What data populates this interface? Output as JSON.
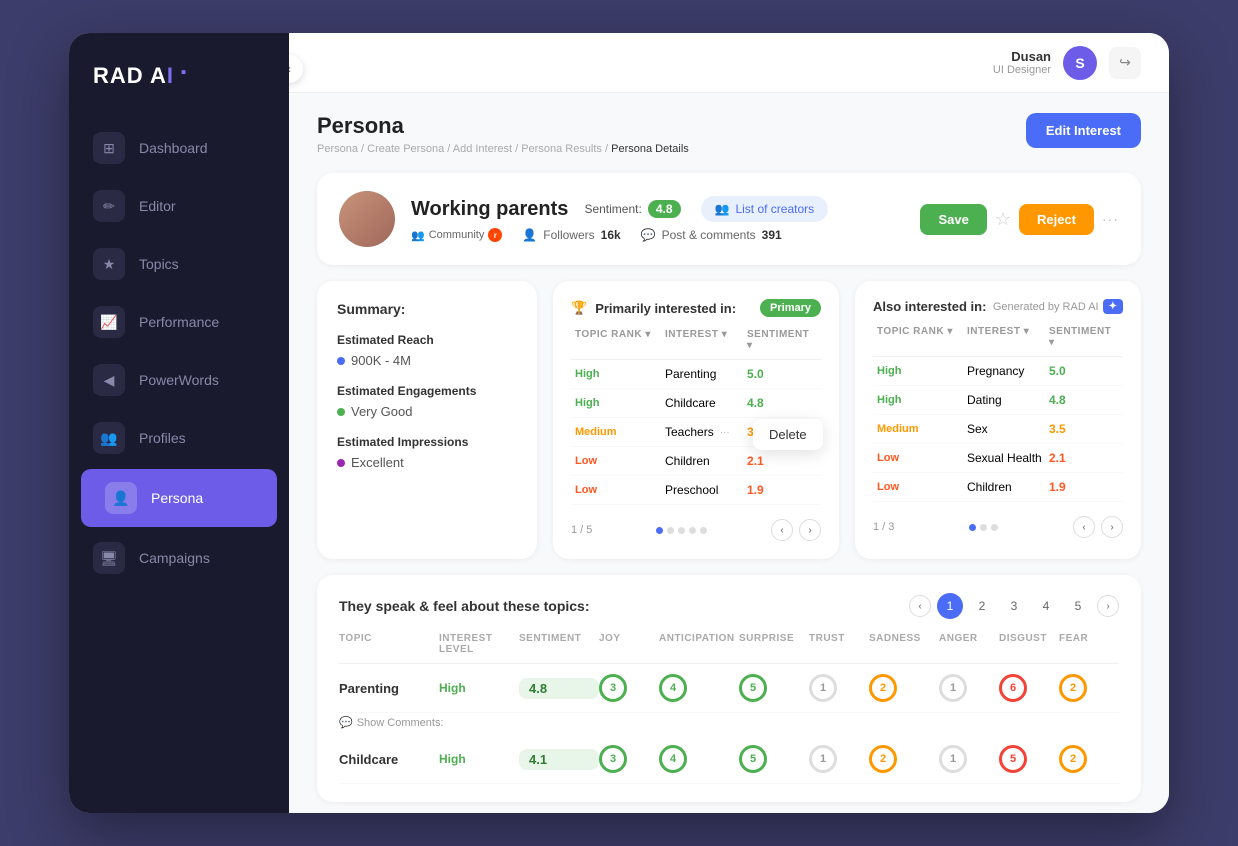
{
  "app": {
    "logo": "RAD AI",
    "logo_dot": "●"
  },
  "header": {
    "user_name": "Dusan",
    "user_role": "UI Designer",
    "avatar_letter": "S",
    "back_arrow": "‹"
  },
  "sidebar": {
    "items": [
      {
        "id": "dashboard",
        "label": "Dashboard",
        "icon": "⊞"
      },
      {
        "id": "editor",
        "label": "Editor",
        "icon": "✏"
      },
      {
        "id": "topics",
        "label": "Topics",
        "icon": "★"
      },
      {
        "id": "performance",
        "label": "Performance",
        "icon": "📈"
      },
      {
        "id": "powerwords",
        "label": "PowerWords",
        "icon": "◀"
      },
      {
        "id": "profiles",
        "label": "Profiles",
        "icon": "👥"
      },
      {
        "id": "persona",
        "label": "Persona",
        "icon": "👤",
        "active": true
      },
      {
        "id": "campaigns",
        "label": "Campaigns",
        "icon": "🖥"
      }
    ]
  },
  "page": {
    "title": "Persona",
    "breadcrumb": "Persona / Create Persona / Add Interest / Persona Results / Persona Details",
    "breadcrumb_active": "Persona Details",
    "edit_btn": "Edit Interest"
  },
  "profile": {
    "name": "Working parents",
    "sentiment_label": "Sentiment:",
    "sentiment_value": "4.8",
    "creators_btn": "List of creators",
    "community": "Community",
    "followers_label": "Followers",
    "followers_value": "16k",
    "post_comments_label": "Post & comments",
    "post_comments_value": "391",
    "save_btn": "Save",
    "reject_btn": "Reject"
  },
  "summary": {
    "title": "Summary:",
    "reach_label": "Estimated Reach",
    "reach_value": "900K - 4M",
    "engagements_label": "Estimated Engagements",
    "engagements_value": "Very Good",
    "impressions_label": "Estimated Impressions",
    "impressions_value": "Excellent"
  },
  "primary_interests": {
    "title": "Primarily interested in:",
    "badge": "Primary",
    "page_indicator": "1 / 5",
    "columns": [
      "Topic Rank",
      "Interest",
      "Sentiment"
    ],
    "rows": [
      {
        "rank": "High",
        "rank_class": "high",
        "topic": "Parenting",
        "sentiment": "5.0",
        "sentiment_class": "green"
      },
      {
        "rank": "High",
        "rank_class": "high",
        "topic": "Childcare",
        "sentiment": "4.8",
        "sentiment_class": "green"
      },
      {
        "rank": "Medium",
        "rank_class": "medium",
        "topic": "Teachers",
        "sentiment": "3.5",
        "sentiment_class": "orange",
        "has_tooltip": true
      },
      {
        "rank": "Low",
        "rank_class": "low",
        "topic": "Children",
        "sentiment": "2.1",
        "sentiment_class": "red"
      },
      {
        "rank": "Low",
        "rank_class": "low",
        "topic": "Preschool",
        "sentiment": "1.9",
        "sentiment_class": "red"
      }
    ],
    "delete_tooltip": "Delete"
  },
  "also_interests": {
    "title": "Also interested in:",
    "generated_label": "Generated by RAD AI",
    "rad_badge": "✦",
    "page_indicator": "1 / 3",
    "columns": [
      "Topic Rank",
      "Interest",
      "Sentiment"
    ],
    "rows": [
      {
        "rank": "High",
        "rank_class": "high",
        "topic": "Pregnancy",
        "sentiment": "5.0",
        "sentiment_class": "green"
      },
      {
        "rank": "High",
        "rank_class": "high",
        "topic": "Dating",
        "sentiment": "4.8",
        "sentiment_class": "green"
      },
      {
        "rank": "Medium",
        "rank_class": "medium",
        "topic": "Sex",
        "sentiment": "3.5",
        "sentiment_class": "orange"
      },
      {
        "rank": "Low",
        "rank_class": "low",
        "topic": "Sexual Health",
        "sentiment": "2.1",
        "sentiment_class": "red"
      },
      {
        "rank": "Low",
        "rank_class": "low",
        "topic": "Children",
        "sentiment": "1.9",
        "sentiment_class": "red"
      }
    ]
  },
  "speak_topics": {
    "title": "They speak & feel about these topics:",
    "pages": [
      1,
      2,
      3,
      4,
      5
    ],
    "active_page": 1,
    "col_headers": [
      "TOPIC",
      "INTEREST LEVEL",
      "SENTIMENT",
      "JOY",
      "ANTICIPATION",
      "SURPRISE",
      "TRUST",
      "SADNESS",
      "ANGER",
      "DISGUST",
      "FEAR"
    ],
    "rows": [
      {
        "topic": "Parenting",
        "interest": "High",
        "sentiment": "4.8",
        "joy": 3,
        "anticipation": 4,
        "surprise": 5,
        "trust": 1,
        "sadness": 2,
        "anger": 1,
        "disgust": 6,
        "fear": 2,
        "joy_class": "green",
        "anticipation_class": "green",
        "surprise_class": "green",
        "trust_class": "gray",
        "sadness_class": "orange",
        "anger_class": "gray",
        "disgust_class": "red",
        "fear_class": "orange",
        "show_comments": "Show Comments:"
      },
      {
        "topic": "Childcare",
        "interest": "High",
        "sentiment": "4.1",
        "joy": 3,
        "anticipation": 4,
        "surprise": 5,
        "trust": 1,
        "sadness": 2,
        "anger": 1,
        "disgust": 5,
        "fear": 2,
        "joy_class": "green",
        "anticipation_class": "green",
        "surprise_class": "green",
        "trust_class": "gray",
        "sadness_class": "orange",
        "anger_class": "gray",
        "disgust_class": "red",
        "fear_class": "orange"
      }
    ]
  }
}
